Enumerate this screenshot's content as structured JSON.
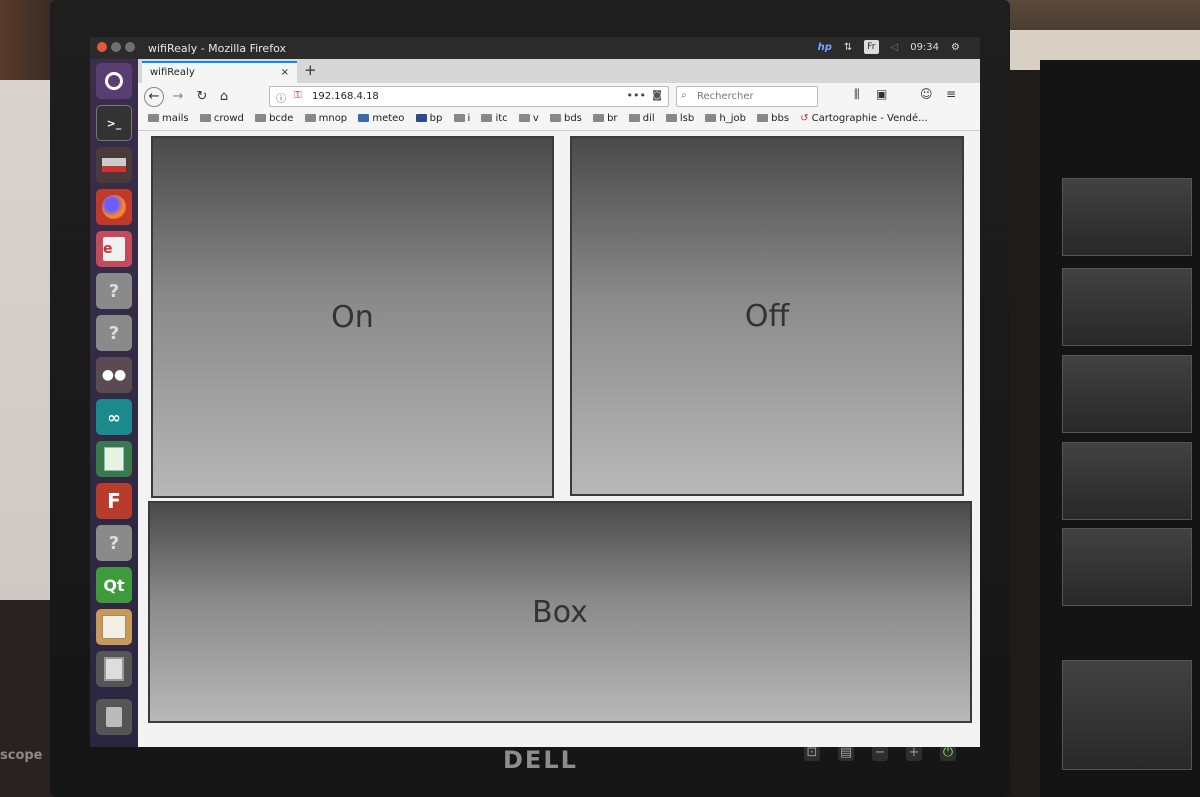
{
  "window": {
    "title": "wifiRealy - Mozilla Firefox"
  },
  "tray": {
    "lang": "Fr",
    "time": "09:34",
    "hp": "hp"
  },
  "tabs": [
    {
      "label": "wifiRealy",
      "close": "×"
    }
  ],
  "new_tab": "+",
  "address": {
    "url": "192.168.4.18",
    "dots": "•••"
  },
  "search": {
    "placeholder": "Rechercher"
  },
  "bookmarks": [
    "mails",
    "crowd",
    "bcde",
    "mnop",
    "meteo",
    "bp",
    "i",
    "itc",
    "v",
    "bds",
    "br",
    "dil",
    "lsb",
    "h_job",
    "bbs",
    "Cartographie - Vendé..."
  ],
  "buttons": {
    "on": "On",
    "off": "Off",
    "box": "Box"
  },
  "hardware": {
    "brand": "DELL",
    "side_label": "scope"
  },
  "launcher": [
    "ubuntu-logo",
    "terminal",
    "stack",
    "firefox",
    "document-viewer",
    "unknown",
    "unknown",
    "gimp",
    "arduino",
    "spreadsheet",
    "fritzing",
    "unknown",
    "qt-creator",
    "schematic",
    "calculator",
    "trash"
  ]
}
